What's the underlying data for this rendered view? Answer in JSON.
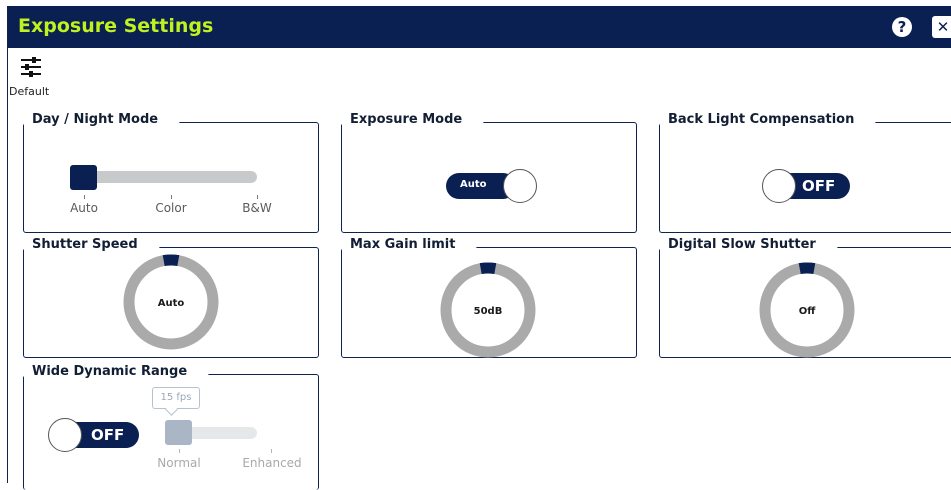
{
  "window": {
    "title": "Exposure Settings",
    "help_glyph": "?",
    "close_glyph": "✕"
  },
  "toolbar": {
    "default_label": "Default",
    "default_icon": "sliders-icon"
  },
  "colors": {
    "titlebar": "#0a2052",
    "title_text": "#bff21e",
    "accent": "#0a2052",
    "track": "#c8c9cb",
    "donut_ring": "#aaaaaa"
  },
  "day_night": {
    "title": "Day / Night Mode",
    "options": [
      "Auto",
      "Color",
      "B&W"
    ],
    "selected": "Auto"
  },
  "exposure_mode": {
    "title": "Exposure Mode",
    "value": "Auto"
  },
  "backlight": {
    "title": "Back Light Compensation",
    "value": "OFF"
  },
  "shutter_speed": {
    "title": "Shutter Speed",
    "value": "Auto"
  },
  "max_gain": {
    "title": "Max Gain limit",
    "value": "50dB"
  },
  "digital_slow_shutter": {
    "title": "Digital Slow Shutter",
    "value": "Off"
  },
  "wdr": {
    "title": "Wide Dynamic Range",
    "toggle_value": "OFF",
    "tooltip": "15 fps",
    "options": [
      "Normal",
      "Enhanced"
    ],
    "selected": "Normal"
  }
}
